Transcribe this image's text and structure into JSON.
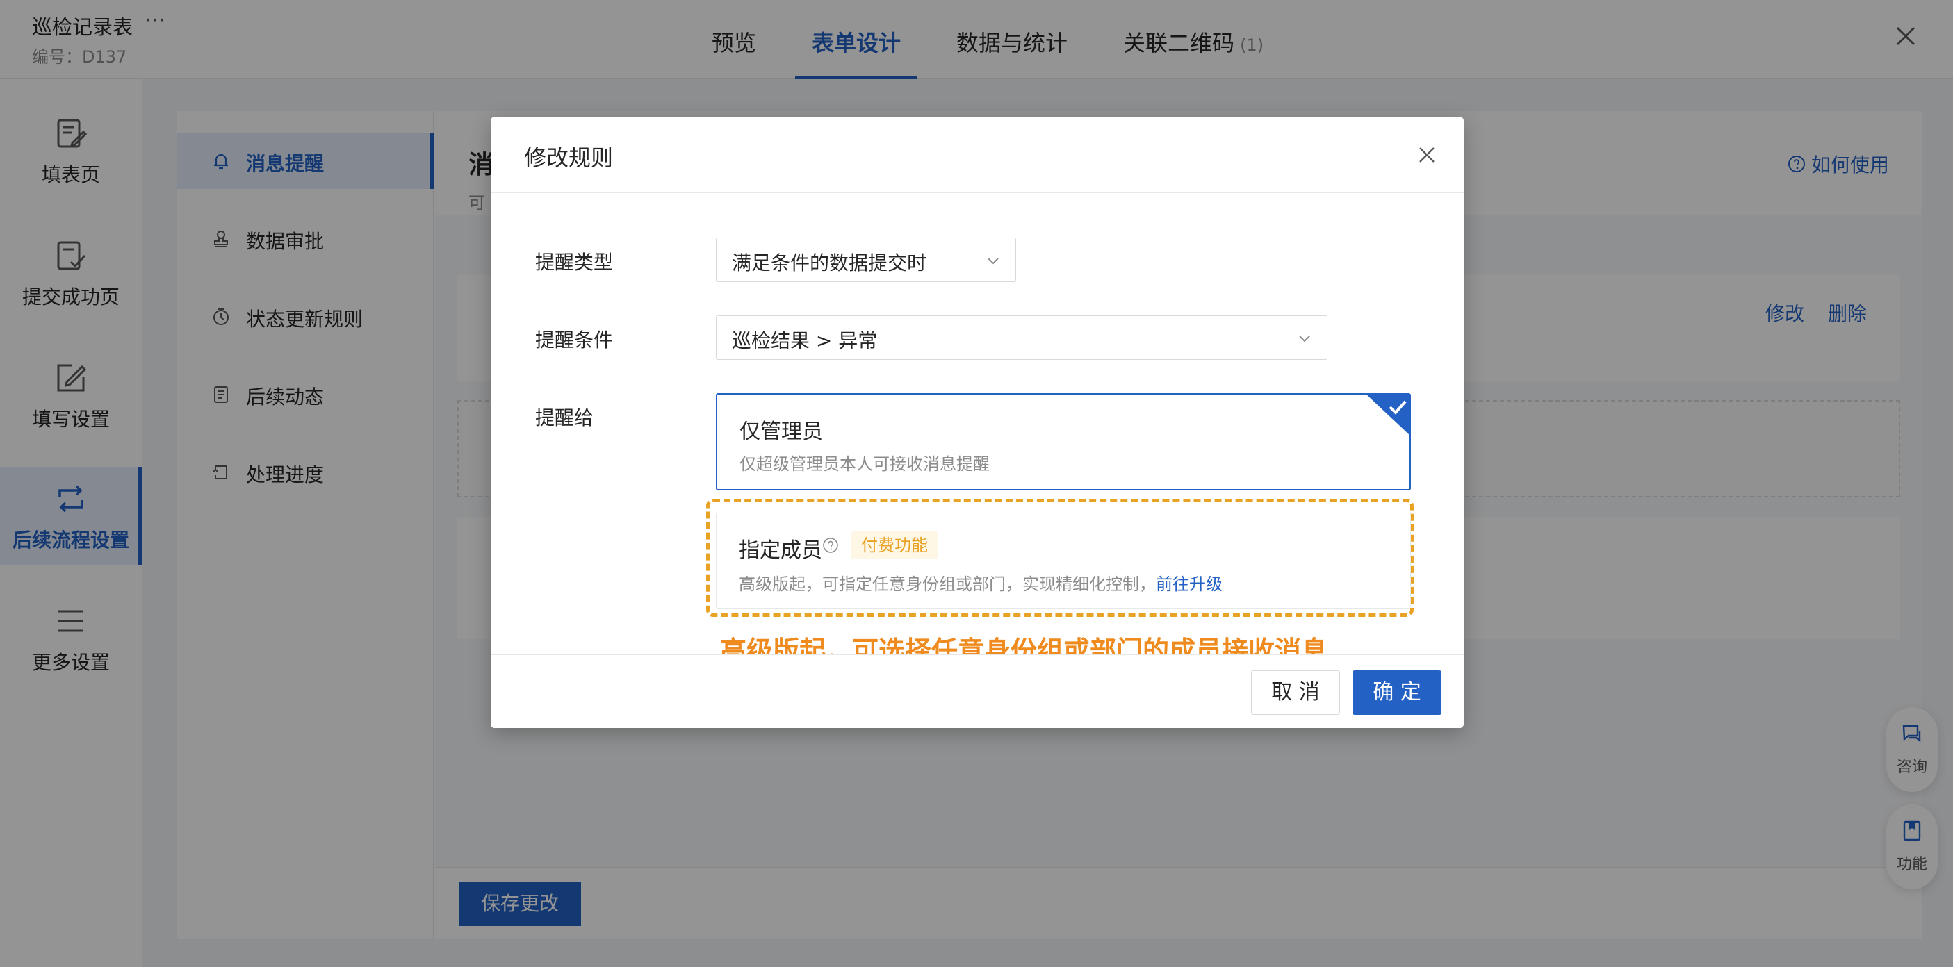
{
  "header": {
    "title": "巡检记录表",
    "more": "···",
    "code": "编号：D137",
    "tabs": [
      {
        "label": "预览"
      },
      {
        "label": "表单设计"
      },
      {
        "label": "数据与统计"
      },
      {
        "label": "关联二维码",
        "count": "(1)"
      }
    ]
  },
  "leftnav": [
    {
      "label": "填表页"
    },
    {
      "label": "提交成功页"
    },
    {
      "label": "填写设置"
    },
    {
      "label": "后续流程设置"
    },
    {
      "label": "更多设置"
    }
  ],
  "submenu": [
    {
      "label": "消息提醒"
    },
    {
      "label": "数据审批"
    },
    {
      "label": "状态更新规则"
    },
    {
      "label": "后续动态"
    },
    {
      "label": "处理进度"
    }
  ],
  "main": {
    "title": "消",
    "subtitle": "可",
    "help": "如何使用",
    "rule_actions": {
      "edit": "修改",
      "delete": "删除"
    },
    "save": "保存更改"
  },
  "floating": {
    "consult": "咨询",
    "feature": "功能"
  },
  "modal": {
    "title": "修改规则",
    "fields": {
      "type_label": "提醒类型",
      "type_value": "满足条件的数据提交时",
      "condition_label": "提醒条件",
      "condition_value": "巡检结果 > 异常",
      "target_label": "提醒给"
    },
    "option_admin": {
      "title": "仅管理员",
      "desc": "仅超级管理员本人可接收消息提醒"
    },
    "option_members": {
      "title": "指定成员",
      "badge": "付费功能",
      "desc": "高级版起，可指定任意身份组或部门，实现精细化控制，",
      "link": "前往升级"
    },
    "annotation": "高级版起，可选择任意身份组或部门的成员接收消息",
    "cancel": "取 消",
    "ok": "确 定"
  },
  "colors": {
    "primary": "#2461c4",
    "accent": "#e8a325",
    "annotation": "#ef8b1e"
  }
}
